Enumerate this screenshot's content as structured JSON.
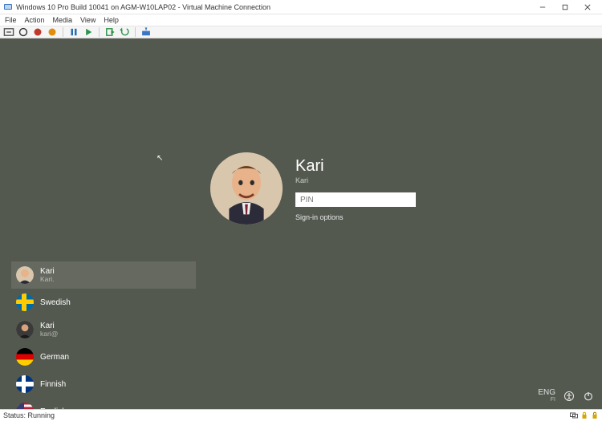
{
  "window": {
    "title": "Windows 10 Pro Build 10041 on AGM-W10LAP02 - Virtual Machine Connection"
  },
  "menubar": {
    "file": "File",
    "action": "Action",
    "media": "Media",
    "view": "View",
    "help": "Help"
  },
  "statusbar": {
    "status": "Status: Running"
  },
  "login": {
    "display_name": "Kari",
    "email": "Kari",
    "pin_placeholder": "PIN",
    "signin_options": "Sign-in options"
  },
  "users": [
    {
      "name": "Kari",
      "sub": "Kari."
    },
    {
      "name": "Swedish",
      "sub": ""
    },
    {
      "name": "Kari",
      "sub": "kari@"
    },
    {
      "name": "German",
      "sub": ""
    },
    {
      "name": "Finnish",
      "sub": ""
    },
    {
      "name": "English",
      "sub": ""
    }
  ],
  "bottom_right": {
    "lang_primary": "ENG",
    "lang_secondary": "FI"
  }
}
